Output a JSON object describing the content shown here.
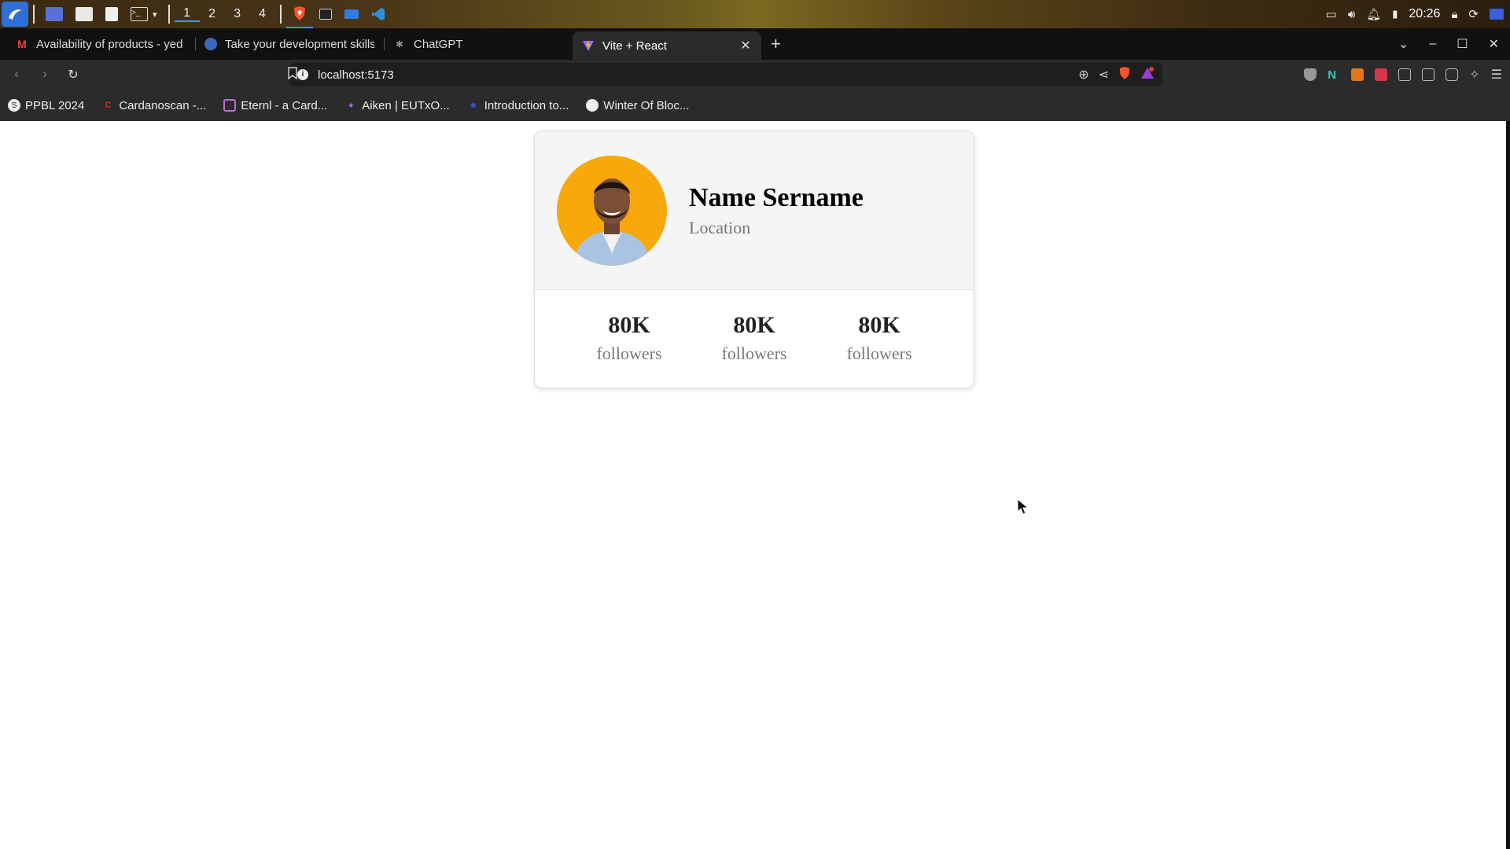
{
  "taskbar": {
    "workspaces": [
      "1",
      "2",
      "3",
      "4"
    ],
    "clock": "20:26"
  },
  "browser": {
    "tabs": [
      {
        "title": "Availability of products - yed",
        "favicon": "gmail-icon"
      },
      {
        "title": "Take your development skills",
        "favicon": "cardano-icon"
      },
      {
        "title": "ChatGPT",
        "favicon": "chatgpt-icon"
      },
      {
        "title": "Vite + React",
        "favicon": "vite-icon",
        "active": true
      }
    ],
    "new_tab": "+",
    "url": "localhost:5173",
    "bookmarks": [
      {
        "label": "PPBL 2024"
      },
      {
        "label": "Cardanoscan -..."
      },
      {
        "label": "Eternl - a Card..."
      },
      {
        "label": "Aiken | EUTxO..."
      },
      {
        "label": "Introduction to..."
      },
      {
        "label": "Winter Of Bloc..."
      }
    ]
  },
  "profile_card": {
    "name": "Name Sername",
    "location": "Location",
    "stats": [
      {
        "value": "80K",
        "label": "followers"
      },
      {
        "value": "80K",
        "label": "followers"
      },
      {
        "value": "80K",
        "label": "followers"
      }
    ]
  },
  "colors": {
    "avatar_bg": "#f7a90c",
    "card_header_bg": "#f5f5f5",
    "brave_orange": "#fb542b",
    "browser_bg": "#2b2b2b"
  }
}
